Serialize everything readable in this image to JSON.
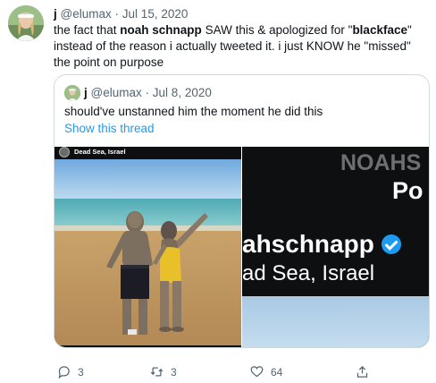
{
  "tweet": {
    "display_name": "j",
    "handle": "@elumax",
    "date": "Jul 15, 2020",
    "text_parts": {
      "p1": "the fact that ",
      "b1": "noah schnapp",
      "p2": " SAW this & apologized for \"",
      "b2": "blackface",
      "p3": "\" instead of the reason i actually tweeted it. i just KNOW he \"missed\" the point on purpose"
    },
    "separator": "·"
  },
  "quoted_tweet": {
    "display_name": "j",
    "handle": "@elumax",
    "date": "Jul 8, 2020",
    "text": "should've unstanned him the moment he did this",
    "show_thread_label": "Show this thread",
    "media_left": {
      "caption": "Dead Sea, Israel"
    },
    "media_right": {
      "text_line1": "NOAHS",
      "text_line2": "Po",
      "username": "ahschnapp",
      "location": "ad Sea, Israel"
    }
  },
  "actions": {
    "reply_count": "3",
    "retweet_count": "3",
    "like_count": "64"
  },
  "colors": {
    "link_blue": "#1d9bf0",
    "secondary_text": "#536471",
    "border": "#cfd9de"
  },
  "icons": [
    "reply-icon",
    "retweet-icon",
    "like-icon",
    "share-icon",
    "verified-badge-icon"
  ]
}
